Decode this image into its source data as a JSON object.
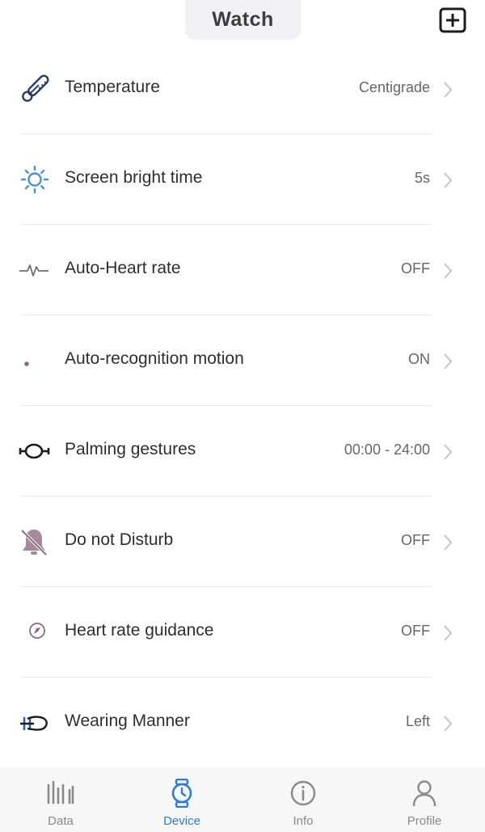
{
  "header": {
    "title": "Watch",
    "add_icon": "plus-square-icon"
  },
  "settings": [
    {
      "label": "Temperature",
      "value": "Centigrade",
      "icon": "thermometer-icon"
    },
    {
      "label": "Screen bright time",
      "value": "5s",
      "icon": "sun-icon"
    },
    {
      "label": "Auto-Heart rate",
      "value": "OFF",
      "icon": "heartbeat-icon"
    },
    {
      "label": "Auto-recognition motion",
      "value": "ON",
      "icon": "motion-dot-icon"
    },
    {
      "label": "Palming gestures",
      "value": "00:00 - 24:00",
      "icon": "wrist-gesture-icon"
    },
    {
      "label": "Do not Disturb",
      "value": "OFF",
      "icon": "bell-off-icon"
    },
    {
      "label": "Heart rate guidance",
      "value": "OFF",
      "icon": "compass-icon"
    },
    {
      "label": "Wearing Manner",
      "value": "Left",
      "icon": "wrist-hand-icon"
    }
  ],
  "tabs": [
    {
      "label": "Data",
      "icon": "bars-icon",
      "active": false
    },
    {
      "label": "Device",
      "icon": "watch-icon",
      "active": true
    },
    {
      "label": "Info",
      "icon": "info-icon",
      "active": false
    },
    {
      "label": "Profile",
      "icon": "person-icon",
      "active": false
    }
  ],
  "colors": {
    "accent": "#2f7bd9",
    "inactive": "#8a8a8a",
    "icon_purple": "#8c6b82",
    "sun_blue": "#4a90d9"
  }
}
